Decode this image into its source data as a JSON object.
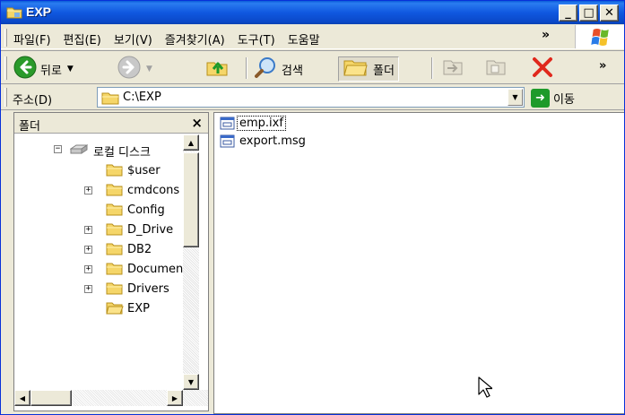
{
  "window": {
    "title": "EXP"
  },
  "caption_buttons": {
    "minimize": "_",
    "maximize": "□",
    "close": "✕"
  },
  "menu": {
    "items": [
      "파일(F)",
      "편집(E)",
      "보기(V)",
      "즐겨찾기(A)",
      "도구(T)",
      "도움말"
    ],
    "more": "»"
  },
  "toolbar": {
    "back_label": "뒤로",
    "search_label": "검색",
    "folders_label": "폴더",
    "more": "»"
  },
  "address": {
    "label": "주소(D)",
    "path": "C:\\EXP",
    "go_label": "이동"
  },
  "folders_pane": {
    "title": "폴더",
    "close": "×",
    "tree": [
      {
        "label": "로컬 디스크",
        "expander": "−"
      },
      {
        "label": "$user",
        "expander": ""
      },
      {
        "label": "cmdcons",
        "expander": "+"
      },
      {
        "label": "Config",
        "expander": ""
      },
      {
        "label": "D_Drive",
        "expander": "+"
      },
      {
        "label": "DB2",
        "expander": "+"
      },
      {
        "label": "Documents",
        "expander": "+"
      },
      {
        "label": "Drivers",
        "expander": "+"
      },
      {
        "label": "EXP",
        "expander": ""
      }
    ]
  },
  "files": [
    {
      "name": "emp.ixf",
      "icon": "file-icon"
    },
    {
      "name": "export.msg",
      "icon": "file-icon"
    }
  ],
  "colors": {
    "titlebar": "#0a5bd8",
    "chrome": "#ece9d8",
    "folder": "#f5d669",
    "go": "#1e9a2a"
  }
}
